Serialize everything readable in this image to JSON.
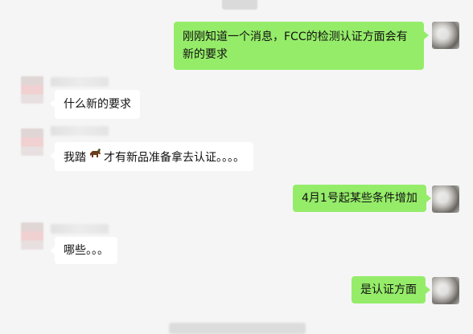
{
  "messages": [
    {
      "from": "self",
      "text": "刚刚知道一个消息，FCC的检测认证方面会有新的要求"
    },
    {
      "from": "other",
      "text": "什么新的要求"
    },
    {
      "from": "other",
      "text_before": "我踏",
      "emoji": "horse-icon",
      "text_after": "才有新品准备拿去认证。。。。"
    },
    {
      "from": "self",
      "text": "4月1号起某些条件增加"
    },
    {
      "from": "other",
      "text": "哪些。。。"
    },
    {
      "from": "self",
      "text": "是认证方面"
    }
  ],
  "colors": {
    "background": "#f5f5f5",
    "self_bubble": "#95ec69",
    "other_bubble": "#ffffff"
  }
}
